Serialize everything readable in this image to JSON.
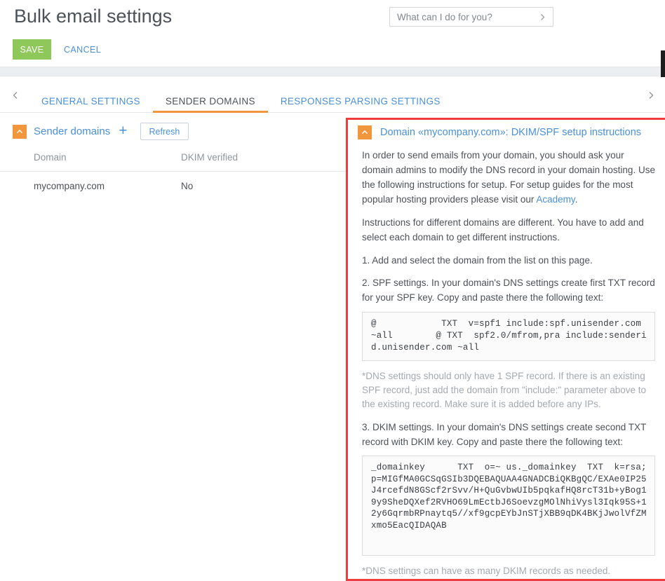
{
  "header": {
    "page_title": "Bulk email settings",
    "save_label": "SAVE",
    "cancel_label": "CANCEL"
  },
  "search": {
    "placeholder": "What can I do for you?",
    "value": "",
    "chevron_icon": "chevron-right-icon"
  },
  "tabs": {
    "prev_icon": "chevron-left-icon",
    "next_icon": "chevron-right-icon",
    "items": [
      {
        "label": "GENERAL SETTINGS",
        "active": false
      },
      {
        "label": "SENDER DOMAINS",
        "active": true
      },
      {
        "label": "RESPONSES PARSING SETTINGS",
        "active": false
      }
    ]
  },
  "left_panel": {
    "collapse_icon": "chevron-up-icon",
    "title": "Sender domains",
    "add_label": "+",
    "refresh_label": "Refresh",
    "table": {
      "columns": [
        "Domain",
        "DKIM verified"
      ],
      "rows": [
        {
          "domain": "mycompany.com",
          "dkim_verified": "No"
        }
      ]
    }
  },
  "right_panel": {
    "collapse_icon": "chevron-up-icon",
    "title": "Domain «mycompany.com»: DKIM/SPF setup instructions",
    "intro_1": "In order to send emails from your domain, you should ask your domain admins to modify the DNS record in your domain hosting. Use the following instructions for setup. For setup guides for the most popular hosting providers please visit our ",
    "intro_1_link": "Academy",
    "intro_1_end": ".",
    "intro_2": "Instructions for different domains are different. You have to add and select each domain to get different instructions.",
    "step_1": "1. Add and select the domain from the list on this page.",
    "step_2": "2. SPF settings. In your domain's DNS settings create first TXT record for your SPF key. Copy and paste there the following text:",
    "spf_record": "@            TXT  v=spf1 include:spf.unisender.com ~all        @ TXT  spf2.0/mfrom,pra include:senderid.unisender.com ~all",
    "spf_note": "*DNS settings should only have 1 SPF record. If there is an existing SPF record, just add the domain from \"include:\" parameter above to the existing record. Make sure it is added before any IPs.",
    "step_3": "3. DKIM settings. In your domain's DNS settings create second TXT record with DKIM key. Copy and paste there the following text:",
    "dkim_record": "_domainkey      TXT  o=~ us._domainkey  TXT  k=rsa; p=MIGfMA0GCSqGSIb3DQEBAQUAA4GNADCBiQKBgQC/EXAe0IP25J4rcefdN8GScf2rSvv/H+QuGvbwUIb5pqkafHQ8rcT31b+yBog19y9SheDQXef2RVHO69LmEctbJ6Soevzg‌MOlNhiVysl3Iqk95S+12y6GqrmbRPnaytq5//xf9gcpEYbJnSTjXBB9qDK4BKjJwolVfZMxmo5EacQIDAQAB",
    "dkim_note": "*DNS settings can have as many DKIM records as needed."
  },
  "colors": {
    "accent_orange": "#f0963c",
    "link_blue": "#4a90d9",
    "save_green": "#8fc85a",
    "highlight_red": "#f03c3c"
  }
}
